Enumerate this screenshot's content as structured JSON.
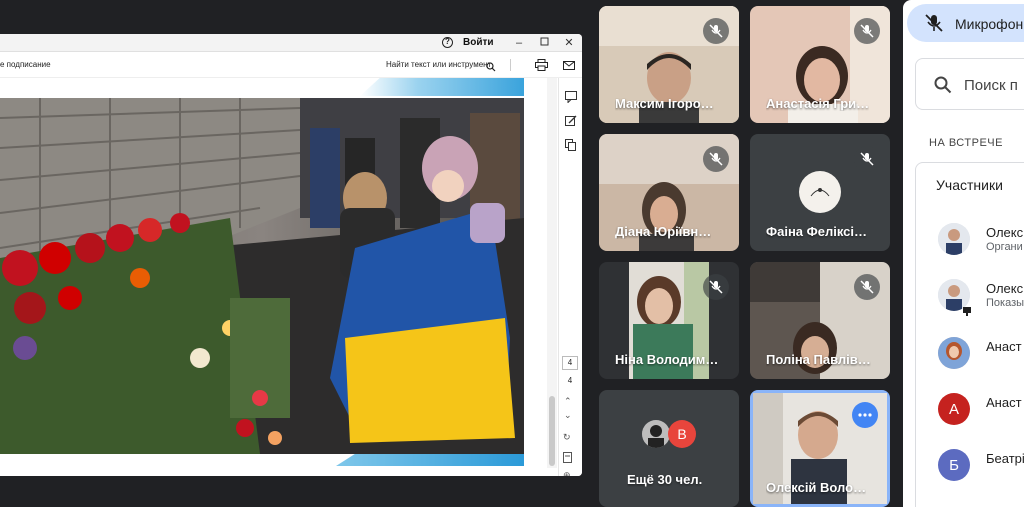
{
  "shared_window": {
    "login_label": "Войти",
    "toolbar_sign_label": "е подписание",
    "find_label": "Найти текст или инструмент",
    "page_current": "4",
    "page_total": "4"
  },
  "tiles": [
    {
      "name": "Максим Ігоро…"
    },
    {
      "name": "Анастасія Гри…"
    },
    {
      "name": "Діана Юріївн…"
    },
    {
      "name": "Фаіна Феліксі…"
    },
    {
      "name": "Ніна Володим…"
    },
    {
      "name": "Поліна Павлів…"
    },
    {
      "name": "Ещё 30 чел.",
      "avatar_letter": "В"
    },
    {
      "name": "Олексій Воло…"
    }
  ],
  "panel": {
    "mic_label": "Микрофон",
    "search_placeholder": "Поиск п",
    "in_meeting_label": "НА ВСТРЕЧЕ",
    "participants_label": "Участники",
    "people": [
      {
        "name": "Олекс",
        "role": "Органи"
      },
      {
        "name": "Олекс",
        "role": "Показы"
      },
      {
        "name": "Анаст",
        "role": ""
      },
      {
        "name": "Анаст",
        "role": "",
        "letter": "А",
        "color": "#c5221f"
      },
      {
        "name": "Беатрі",
        "role": "",
        "letter": "Б",
        "color": "#5c6bc0"
      }
    ]
  },
  "colors": {
    "background": "#202124",
    "tile": "#3c4043",
    "accent_blue": "#4285f4",
    "mic_chip": "#d3e3fd"
  }
}
